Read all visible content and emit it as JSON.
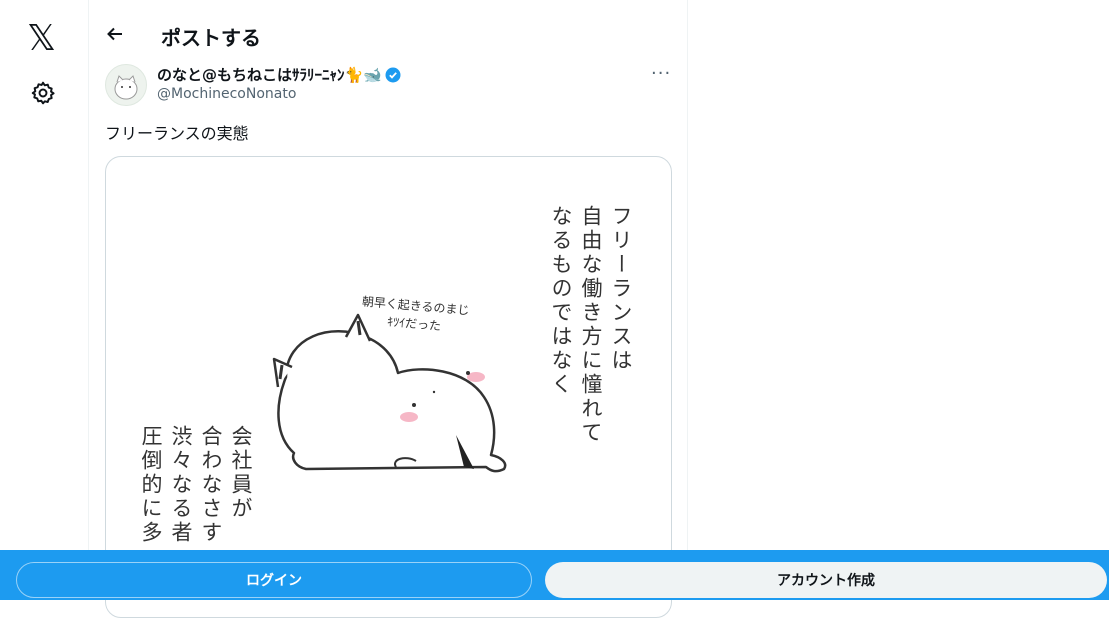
{
  "nav": {
    "logo": "𝕏"
  },
  "header": {
    "title": "ポストする"
  },
  "post": {
    "author_name": "のなと@もちねこはｻﾗﾘｰﾆｬﾝ🐈🐋",
    "handle": "@MochinecoNonato",
    "text": "フリーランスの実態",
    "image": {
      "right_lines": [
        "フリーランスは",
        "自由な働き方に憧れて",
        "なるものではなく"
      ],
      "bubble_lines": [
        "朝早く起きるのまじ",
        "ｷﾂｲだった"
      ],
      "left_lines": [
        "会社員が",
        "合わなさす",
        "渋々なる者",
        "圧倒的に多"
      ]
    }
  },
  "bottom": {
    "login_label": "ログイン",
    "signup_label": "アカウント作成"
  },
  "colors": {
    "accent": "#1d9bf0"
  }
}
